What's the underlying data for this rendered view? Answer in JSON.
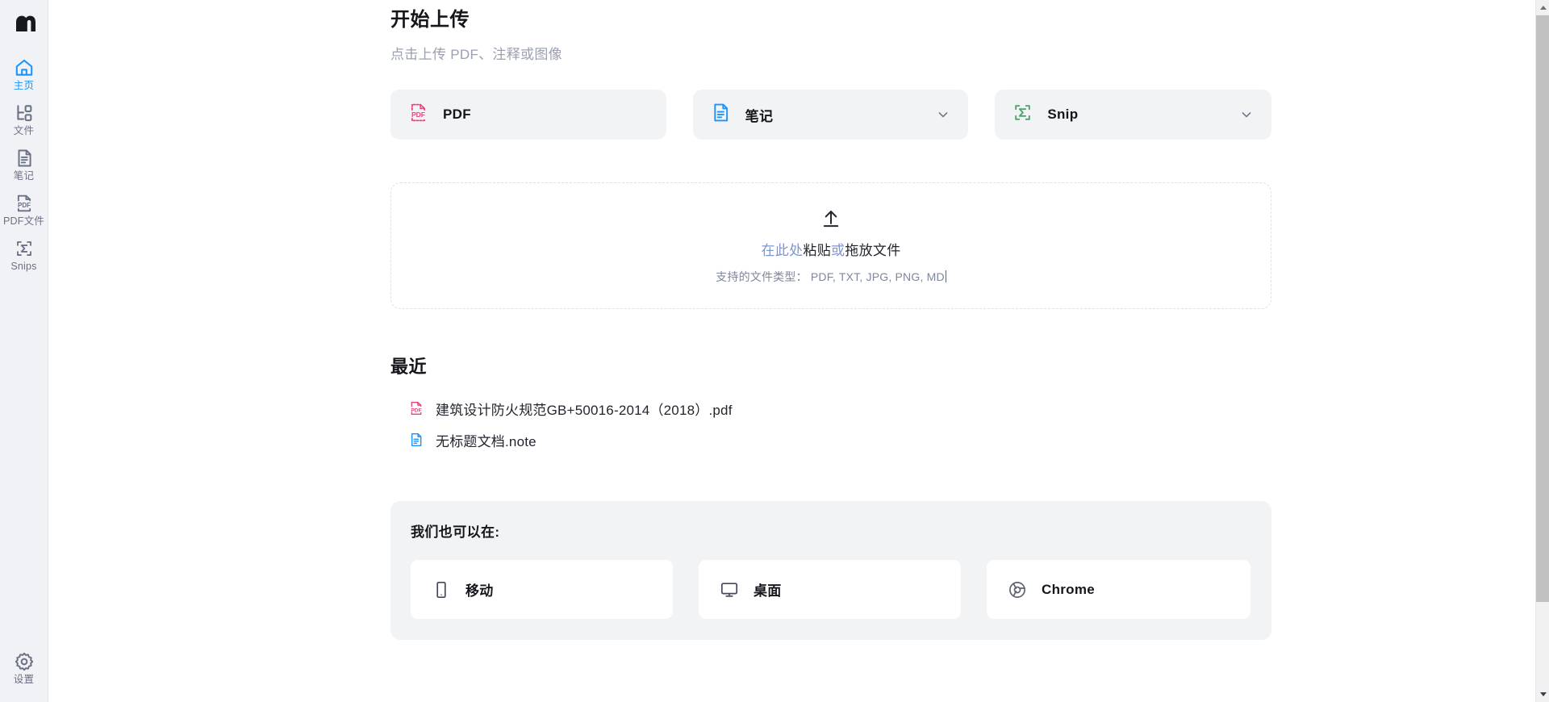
{
  "sidebar": {
    "logo_alt": "app-logo",
    "items": [
      {
        "label": "主页",
        "icon": "home-icon",
        "active": true
      },
      {
        "label": "文件",
        "icon": "files-icon",
        "active": false
      },
      {
        "label": "笔记",
        "icon": "note-icon",
        "active": false
      },
      {
        "label": "PDF文件",
        "icon": "pdf-icon",
        "active": false
      },
      {
        "label": "Snips",
        "icon": "snip-icon",
        "active": false
      }
    ],
    "settings": {
      "label": "设置",
      "icon": "gear-icon"
    }
  },
  "main": {
    "title": "开始上传",
    "subtitle": "点击上传 PDF、注释或图像",
    "upload_types": [
      {
        "label": "PDF",
        "icon": "pdf-file-icon",
        "color": "#e5447d",
        "has_chevron": false
      },
      {
        "label": "笔记",
        "icon": "note-file-icon",
        "color": "#1d93fb",
        "has_chevron": true
      },
      {
        "label": "Snip",
        "icon": "snip-sigma-icon",
        "color": "#4ba56d",
        "has_chevron": true
      }
    ],
    "dropzone": {
      "icon": "upload-arrow-icon",
      "line_link_1": "在此处",
      "line_dark_1": "粘贴",
      "line_link_2": "或",
      "line_dark_2": "拖放文件",
      "supported": "支持的文件类型：  PDF, TXT, JPG, PNG, MD"
    },
    "recent": {
      "title": "最近",
      "items": [
        {
          "name": "建筑设计防火规范GB+50016-2014（2018）.pdf",
          "icon": "pdf-file-icon",
          "color": "#e5447d"
        },
        {
          "name": "无标题文档.note",
          "icon": "note-file-icon",
          "color": "#1d93fb"
        }
      ]
    },
    "platforms": {
      "title": "我们也可以在:",
      "items": [
        {
          "label": "移动",
          "icon": "mobile-icon"
        },
        {
          "label": "桌面",
          "icon": "desktop-icon"
        },
        {
          "label": "Chrome",
          "icon": "chrome-icon"
        }
      ]
    }
  },
  "scrollbar": {
    "up_label": "向上滚动",
    "down_label": "向下滚动"
  },
  "colors": {
    "accent_blue": "#1d93fb",
    "pdf_pink": "#e5447d",
    "snip_green": "#4ba56d",
    "sidebar_bg": "#f1f2f5",
    "card_bg": "#f2f3f5"
  }
}
